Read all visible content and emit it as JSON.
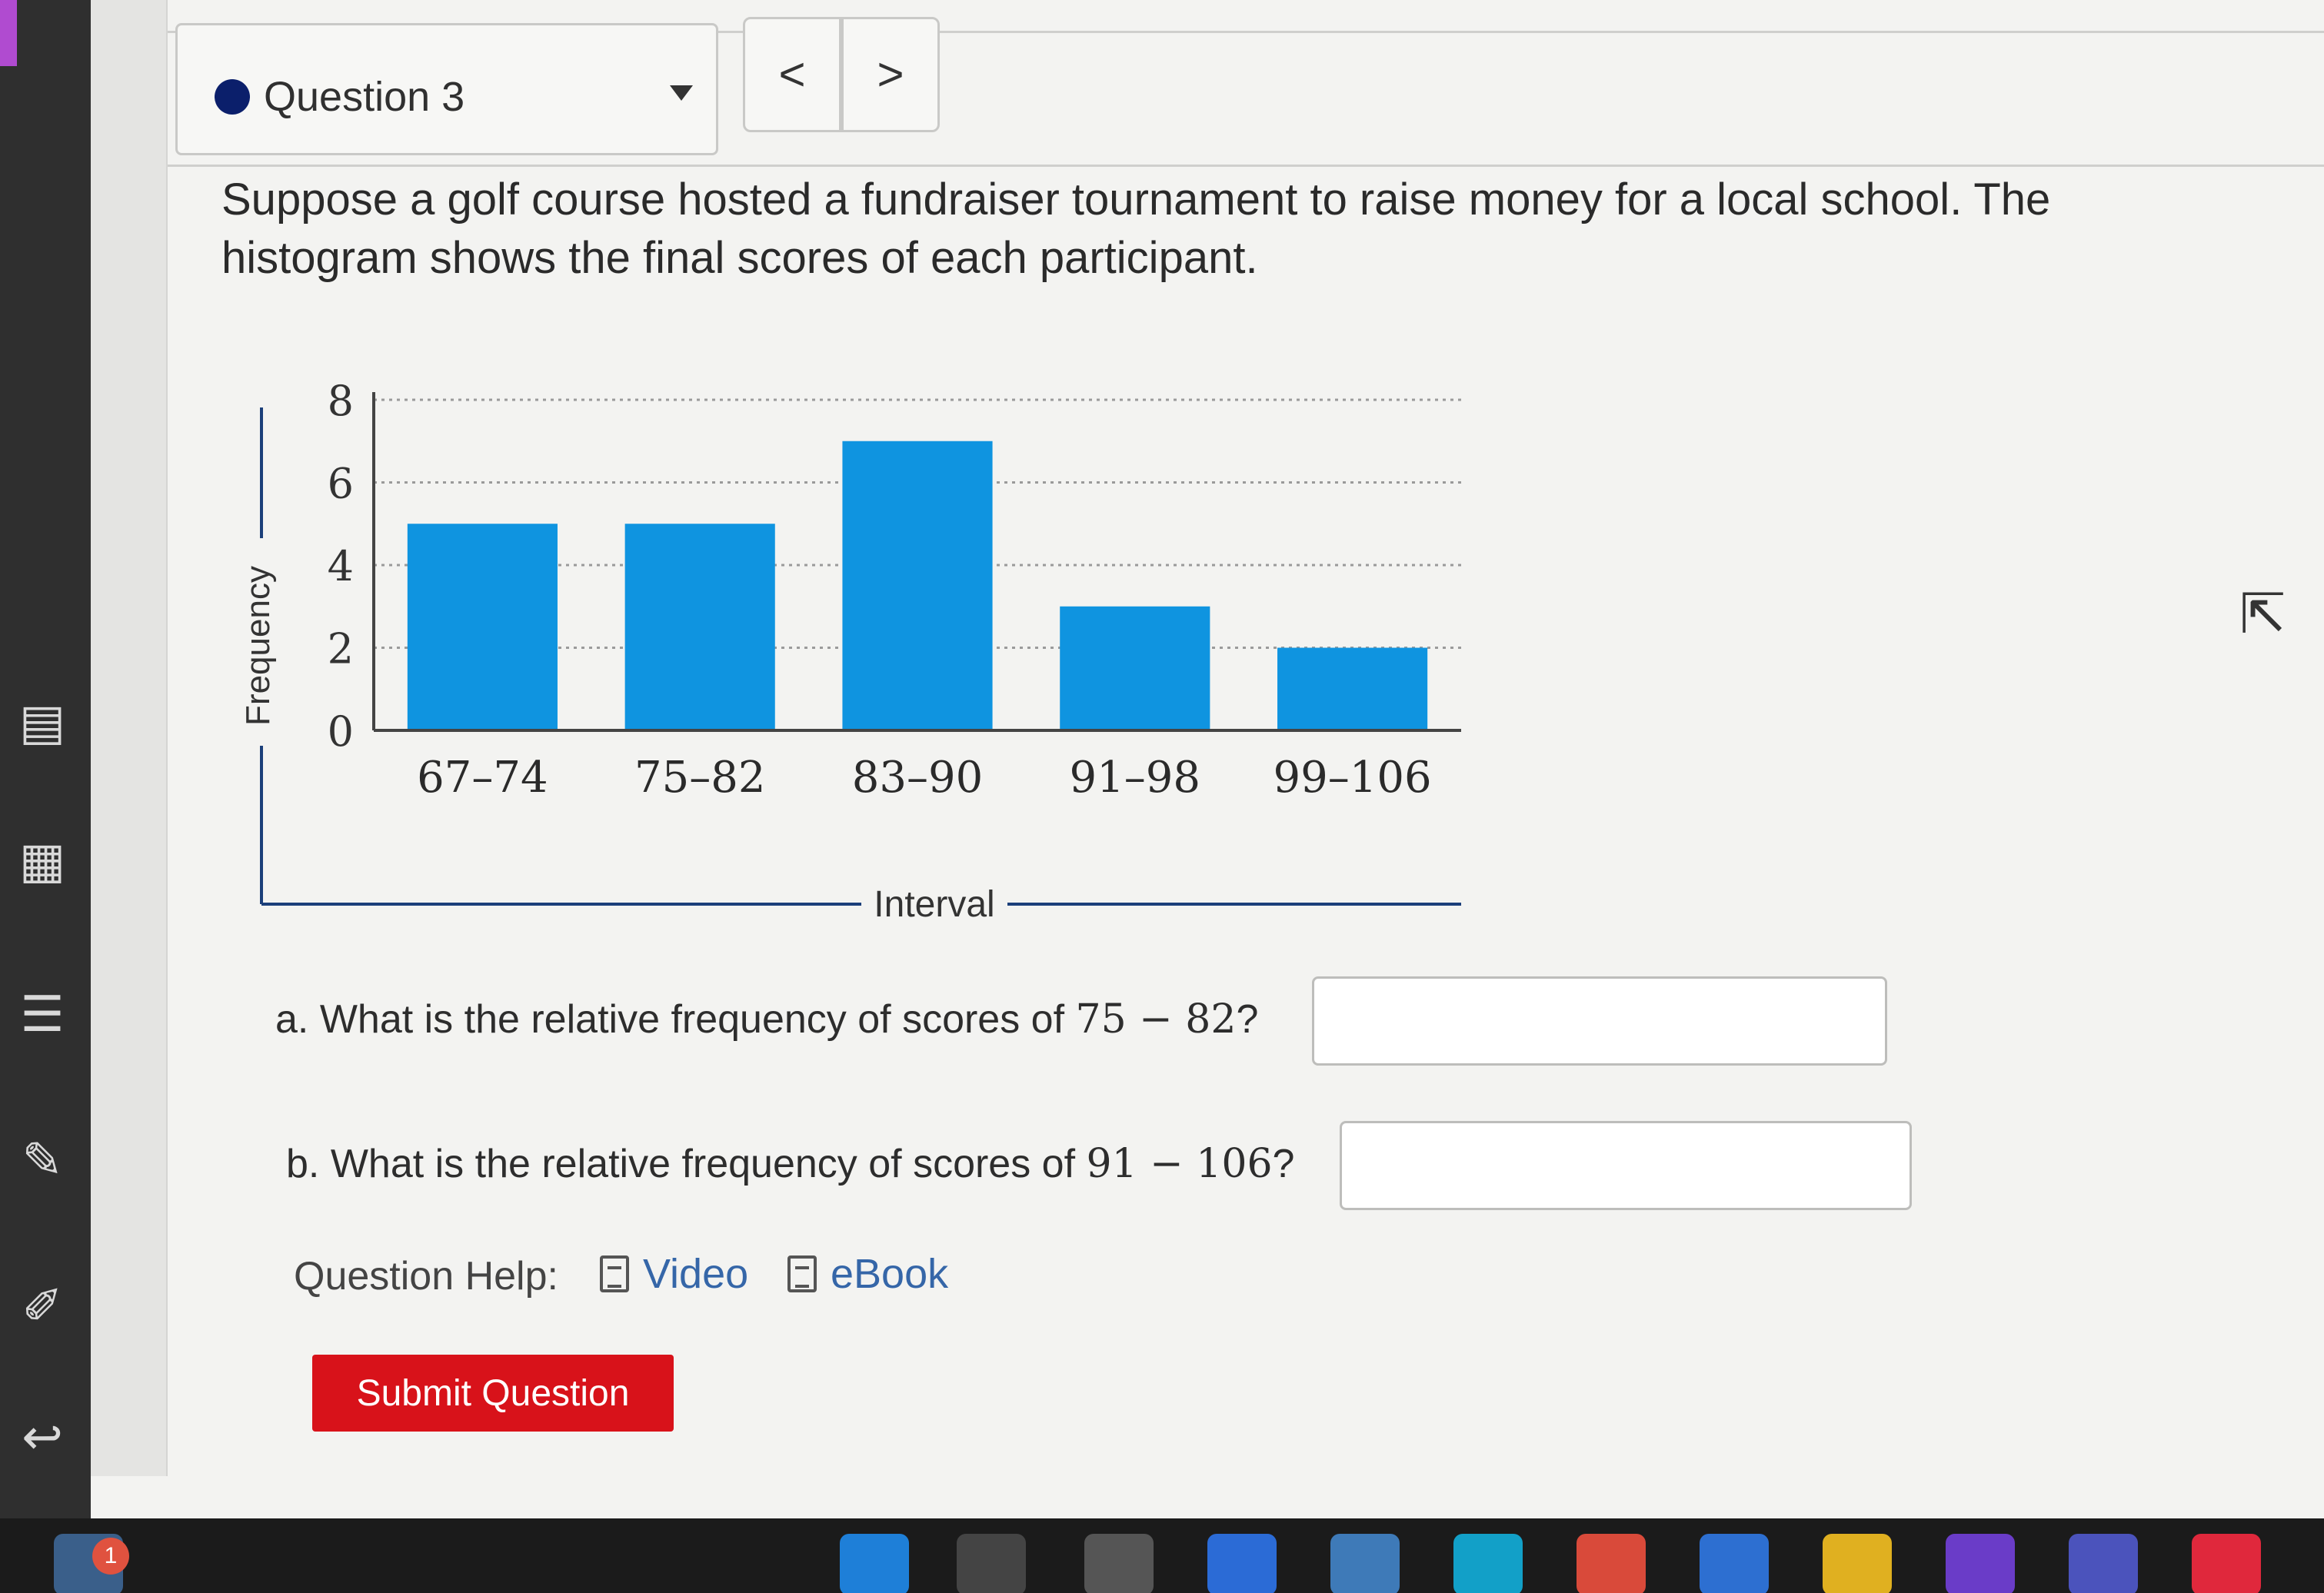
{
  "question_selector": {
    "label": "Question 3",
    "prev_label": "<",
    "next_label": ">"
  },
  "prompt": "Suppose a golf course hosted a fundraiser tournament to raise money for a local school. The histogram shows the final scores of each participant.",
  "chart_data": {
    "type": "bar",
    "categories": [
      "67–74",
      "75–82",
      "83–90",
      "91–98",
      "99–106"
    ],
    "values": [
      5,
      5,
      7,
      3,
      2
    ],
    "xlabel": "Interval",
    "ylabel": "Frequency",
    "ylim": [
      0,
      8
    ],
    "yticks": [
      "0",
      "2",
      "4",
      "6",
      "8"
    ],
    "grid": true,
    "bar_color": "#0f94e0"
  },
  "questions": {
    "a": {
      "prefix": "a. What is the relative frequency of scores of ",
      "math": "75 − 82",
      "suffix": "?",
      "value": ""
    },
    "b": {
      "prefix": "b. What is the relative frequency of scores of ",
      "math": "91 − 106",
      "suffix": "?",
      "value": ""
    }
  },
  "help": {
    "label": "Question Help:",
    "video": "Video",
    "ebook": "eBook"
  },
  "submit_label": "Submit Question",
  "taskbar": {
    "notification_count": "1"
  },
  "colors": {
    "accent_blue": "#0b1f6b",
    "submit_red": "#d8121a",
    "link_blue": "#3566a8",
    "bar_blue": "#0f94e0"
  }
}
